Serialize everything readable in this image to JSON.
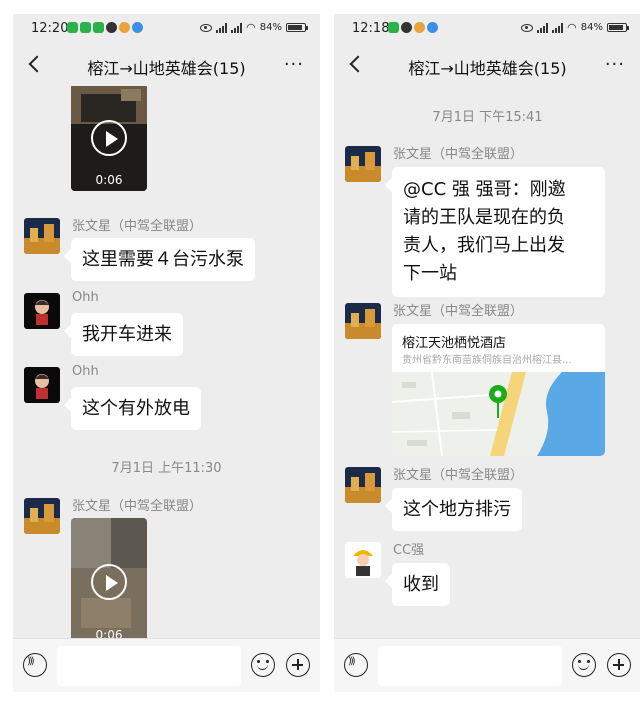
{
  "left": {
    "status": {
      "time": "12:20",
      "battery": "84%"
    },
    "nav": {
      "title": "榕江→山地英雄会(15)",
      "more": "···"
    },
    "video1": {
      "duration": "0:06"
    },
    "messages": [
      {
        "sender": "张文星（中驾全联盟）",
        "text": "这里需要４台污水泵"
      },
      {
        "sender": "Ohh",
        "text": "我开车进来"
      },
      {
        "sender": "Ohh",
        "text": "这个有外放电"
      }
    ],
    "timestamp": "7月1日 上午11:30",
    "video2": {
      "sender": "张文星（中驾全联盟）",
      "duration": "0:06"
    }
  },
  "right": {
    "status": {
      "time": "12:18",
      "battery": "84%"
    },
    "nav": {
      "title": "榕江→山地英雄会(15)",
      "more": "···"
    },
    "timestamp": "7月1日 下午15:41",
    "msg1": {
      "sender": "张文星（中驾全联盟）",
      "lines": [
        "@CC 强  强哥：刚邀",
        "请的王队是现在的负",
        "责人，我们马上出发",
        "下一站"
      ]
    },
    "location": {
      "sender": "张文星（中驾全联盟）",
      "name": "榕江天池栖悦酒店",
      "address": "贵州省黔东南苗族侗族自治州榕江县..."
    },
    "msg3": {
      "sender": "张文星（中驾全联盟）",
      "text": "这个地方排污"
    },
    "msg4": {
      "sender": "CC强",
      "text": "收到"
    }
  },
  "colors": {
    "chat_bg": "#ededed",
    "bubble": "#ffffff",
    "sender": "#888888",
    "map_water": "#5aa9e6",
    "pin": "#1aad19"
  }
}
